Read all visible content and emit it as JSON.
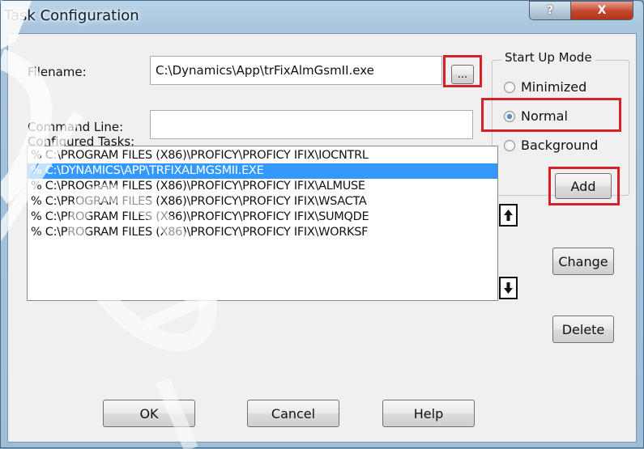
{
  "window": {
    "title": "Task Configuration",
    "help_label": "?",
    "close_label": "X"
  },
  "filename": {
    "label": "Filename:",
    "value": "C:\\Dynamics\\App\\trFixAlmGsmII.exe",
    "browse_label": "..."
  },
  "command_line": {
    "label": "Command Line:",
    "value": ""
  },
  "startup_mode": {
    "title": "Start Up Mode",
    "options": [
      {
        "label": "Minimized",
        "selected": false
      },
      {
        "label": "Normal",
        "selected": true
      },
      {
        "label": "Background",
        "selected": false
      }
    ]
  },
  "tasks": {
    "label": "Configured Tasks:",
    "items": [
      "% C:\\PROGRAM FILES (X86)\\PROFICY\\PROFICY IFIX\\IOCNTRL",
      "% C:\\DYNAMICS\\APP\\TRFIXALMGSMII.EXE",
      "% C:\\PROGRAM FILES (X86)\\PROFICY\\PROFICY IFIX\\ALMUSE",
      "% C:\\PROGRAM FILES (X86)\\PROFICY\\PROFICY IFIX\\WSACTA",
      "% C:\\PROGRAM FILES (X86)\\PROFICY\\PROFICY IFIX\\SUMQDE",
      "% C:\\PROGRAM FILES (X86)\\PROFICY\\PROFICY IFIX\\WORKSF"
    ],
    "selected_index": 1
  },
  "buttons": {
    "add": "Add",
    "change": "Change",
    "delete": "Delete",
    "ok": "OK",
    "cancel": "Cancel",
    "help": "Help"
  },
  "icons": {
    "move_up": "arrow-up-icon",
    "move_down": "arrow-down-icon"
  },
  "colors": {
    "highlight_box": "#d6202a",
    "selection": "#3399ff"
  }
}
